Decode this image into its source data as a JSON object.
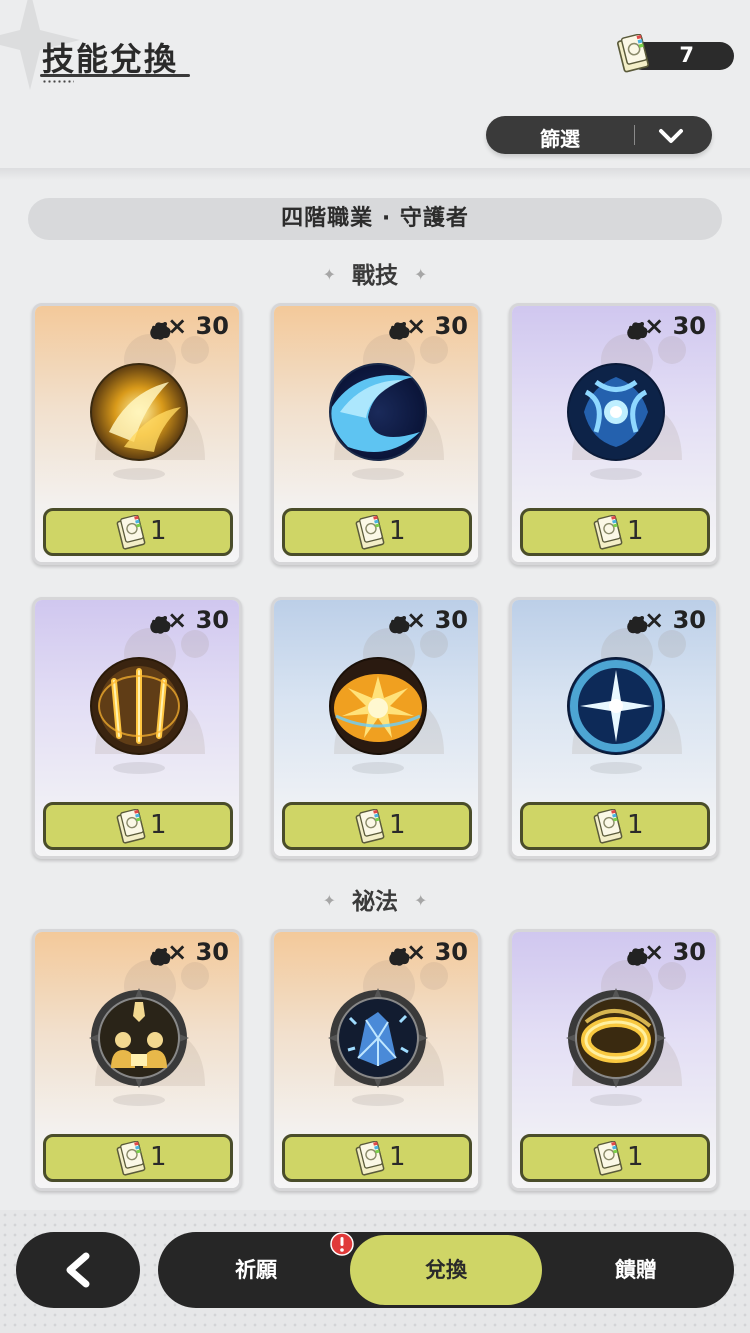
{
  "header": {
    "title": "技能兌換"
  },
  "currency": {
    "count": "7",
    "icon": "ticket-icon"
  },
  "filter": {
    "label": "篩選",
    "icon": "chevron-down-icon"
  },
  "class_banner": "四階職業 · 守護者",
  "sections": [
    {
      "title": "戰技",
      "cards": [
        {
          "theme": "orange",
          "cost": "× 30",
          "price": "1",
          "orb": "golden-slash-icon"
        },
        {
          "theme": "orange",
          "cost": "× 30",
          "price": "1",
          "orb": "water-wave-icon"
        },
        {
          "theme": "purple",
          "cost": "× 30",
          "price": "1",
          "orb": "water-burst-icon"
        },
        {
          "theme": "purple",
          "cost": "× 30",
          "price": "1",
          "orb": "golden-blades-icon"
        },
        {
          "theme": "blue",
          "cost": "× 30",
          "price": "1",
          "orb": "golden-explosion-icon"
        },
        {
          "theme": "blue",
          "cost": "× 30",
          "price": "1",
          "orb": "water-star-icon"
        }
      ]
    },
    {
      "title": "祕法",
      "cards": [
        {
          "theme": "orange",
          "cost": "× 30",
          "price": "1",
          "orb": "party-figures-icon"
        },
        {
          "theme": "orange",
          "cost": "× 30",
          "price": "1",
          "orb": "ice-crystal-icon"
        },
        {
          "theme": "purple",
          "cost": "× 30",
          "price": "1",
          "orb": "golden-ring-icon"
        }
      ]
    }
  ],
  "bottom_nav": {
    "back_icon": "back-arrow-icon",
    "tabs": [
      "祈願",
      "兌換",
      "饋贈"
    ],
    "active_tab": "兌換",
    "alert_icon": "alert-icon"
  },
  "colors": {
    "accent": "#cfd566",
    "dark": "#262626",
    "background": "#ecedee"
  }
}
